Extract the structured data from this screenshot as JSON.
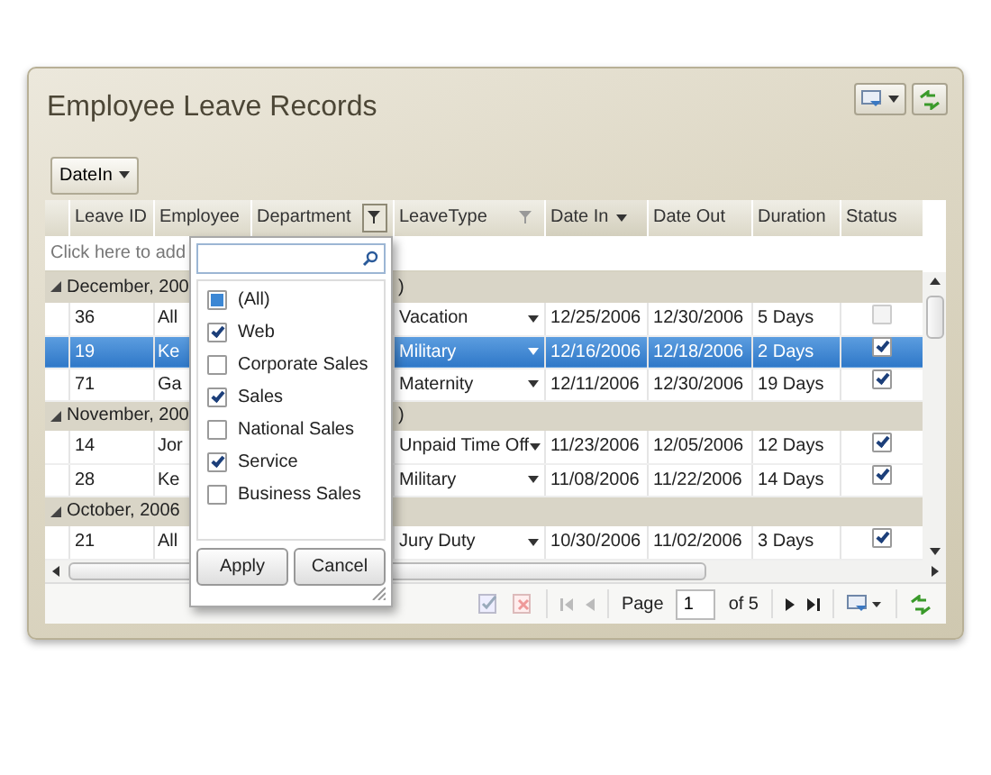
{
  "window_title": "Employee Leave Records",
  "group_by_button": "DateIn",
  "columns": [
    {
      "label": "Leave ID",
      "filter_icon": false,
      "sorted_descending": false
    },
    {
      "label": "Employee",
      "filter_icon": false,
      "sorted_descending": false
    },
    {
      "label": "Department",
      "filter_icon": true,
      "filter_active": true,
      "sorted_descending": false
    },
    {
      "label": "LeaveType",
      "filter_icon": true,
      "filter_active": false,
      "sorted_descending": false
    },
    {
      "label": "Date In",
      "filter_icon": false,
      "sorted_descending": true
    },
    {
      "label": "Date Out",
      "filter_icon": false,
      "sorted_descending": false
    },
    {
      "label": "Duration",
      "filter_icon": false,
      "sorted_descending": false
    },
    {
      "label": "Status",
      "filter_icon": false,
      "sorted_descending": false
    }
  ],
  "new_row_hint": "Click here to add",
  "groups": [
    {
      "label": "December, 200",
      "tail": ")",
      "expanded": true,
      "rows": [
        {
          "leave_id": "36",
          "employee": "All",
          "leave_type": "Vacation",
          "date_in": "12/25/2006",
          "date_out": "12/30/2006",
          "duration": "5 Days",
          "checked": false,
          "selected": false
        },
        {
          "leave_id": "19",
          "employee": "Ke",
          "leave_type": "Military",
          "date_in": "12/16/2006",
          "date_out": "12/18/2006",
          "duration": "2 Days",
          "checked": true,
          "selected": true
        },
        {
          "leave_id": "71",
          "employee": "Ga",
          "leave_type": "Maternity",
          "date_in": "12/11/2006",
          "date_out": "12/30/2006",
          "duration": "19 Days",
          "checked": true,
          "selected": false
        }
      ]
    },
    {
      "label": "November, 200",
      "tail": ")",
      "expanded": true,
      "rows": [
        {
          "leave_id": "14",
          "employee": "Jor",
          "leave_type": "Unpaid Time Off",
          "date_in": "11/23/2006",
          "date_out": "12/05/2006",
          "duration": "12 Days",
          "checked": true,
          "selected": false
        },
        {
          "leave_id": "28",
          "employee": "Ke",
          "leave_type": "Military",
          "date_in": "11/08/2006",
          "date_out": "11/22/2006",
          "duration": "14 Days",
          "checked": true,
          "selected": false
        }
      ]
    },
    {
      "label": "October, 2006",
      "expanded": true,
      "rows": [
        {
          "leave_id": "21",
          "employee": "All",
          "leave_type": "Jury Duty",
          "date_in": "10/30/2006",
          "date_out": "11/02/2006",
          "duration": "3 Days",
          "checked": true,
          "selected": false
        }
      ]
    }
  ],
  "filter_popup": {
    "items": [
      {
        "label": "(All)",
        "checked": false,
        "partial": true
      },
      {
        "label": "Web",
        "checked": true,
        "partial": false
      },
      {
        "label": "Corporate Sales",
        "checked": false,
        "partial": false
      },
      {
        "label": "Sales",
        "checked": true,
        "partial": false
      },
      {
        "label": "National Sales",
        "checked": false,
        "partial": false
      },
      {
        "label": "Service",
        "checked": true,
        "partial": false
      },
      {
        "label": "Business Sales",
        "checked": false,
        "partial": false
      }
    ],
    "buttons": [
      "Apply",
      "Cancel"
    ]
  },
  "pager": {
    "page_label": "Page",
    "page": "1",
    "of_label": "of 5"
  }
}
